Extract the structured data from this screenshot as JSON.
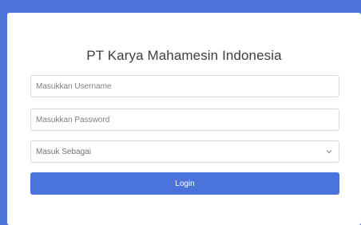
{
  "colors": {
    "background": "#4d74d8",
    "card": "#ffffff",
    "button": "#4b73dc",
    "field_border": "#d8dadf"
  },
  "login": {
    "title": "PT Karya Mahamesin Indonesia",
    "username": {
      "value": "",
      "placeholder": "Masukkan Username"
    },
    "password": {
      "value": "",
      "placeholder": "Masukkan Password"
    },
    "role_select": {
      "selected": "Masuk Sebagai",
      "icon": "chevron-down-icon"
    },
    "button_label": "Login"
  }
}
